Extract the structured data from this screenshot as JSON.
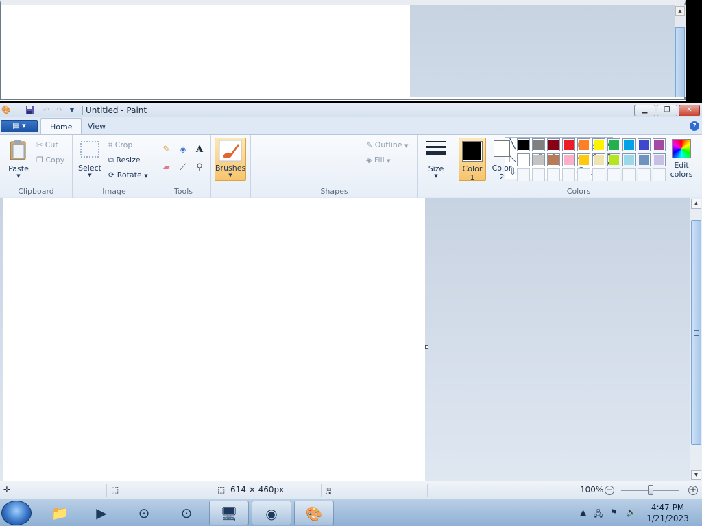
{
  "window": {
    "title": "Untitled - Paint"
  },
  "tabs": [
    {
      "label": "Home"
    },
    {
      "label": "View"
    }
  ],
  "help_glyph": "?",
  "ribbon": {
    "clipboard": {
      "label": "Clipboard",
      "paste": "Paste",
      "cut": "Cut",
      "copy": "Copy"
    },
    "image": {
      "label": "Image",
      "select": "Select",
      "crop": "Crop",
      "resize": "Resize",
      "rotate": "Rotate"
    },
    "tools": {
      "label": "Tools"
    },
    "brushes": {
      "label": "Brushes"
    },
    "shapes": {
      "label": "Shapes",
      "outline": "Outline",
      "fill": "Fill"
    },
    "size": {
      "label": "Size"
    },
    "colors": {
      "label": "Colors",
      "color1": "Color\n1",
      "color1_a": "Color",
      "color1_b": "1",
      "color2_a": "Color",
      "color2_b": "2",
      "edit_a": "Edit",
      "edit_b": "colors",
      "color1_value": "#000000",
      "color2_value": "#ffffff",
      "palette_row1": [
        "#000000",
        "#7f7f7f",
        "#880015",
        "#ed1c24",
        "#ff7f27",
        "#fff200",
        "#22b14c",
        "#00a2e8",
        "#3f48cc",
        "#a349a4"
      ],
      "palette_row2": [
        "#ffffff",
        "#c3c3c3",
        "#b97a57",
        "#ffaec9",
        "#ffc90e",
        "#efe4b0",
        "#b5e61d",
        "#99d9ea",
        "#7092be",
        "#c8bfe7"
      ]
    }
  },
  "status": {
    "size": "614 × 460px",
    "zoom": "100%"
  },
  "taskbar": {
    "time": "4:47 PM",
    "date": "1/21/2023"
  },
  "icons": [
    "paint-app-icon",
    "save-icon",
    "undo-icon",
    "redo-icon",
    "customize-quick-access-icon",
    "minimize-icon",
    "maximize-icon",
    "close-icon",
    "help-icon",
    "paste-icon",
    "cut-icon",
    "copy-icon",
    "select-icon",
    "crop-icon",
    "resize-icon",
    "rotate-icon",
    "pencil-icon",
    "fill-icon",
    "text-icon",
    "eraser-icon",
    "color-picker-icon",
    "magnifier-icon",
    "brush-icon",
    "outline-icon",
    "fill-shape-icon",
    "size-icon",
    "edit-colors-icon",
    "cursor-position-icon",
    "selection-size-icon",
    "image-size-icon",
    "disk-icon",
    "zoom-out-icon",
    "zoom-in-icon",
    "start-icon",
    "file-explorer-icon",
    "media-player-icon",
    "network-icon",
    "volume-icon",
    "action-center-icon"
  ]
}
